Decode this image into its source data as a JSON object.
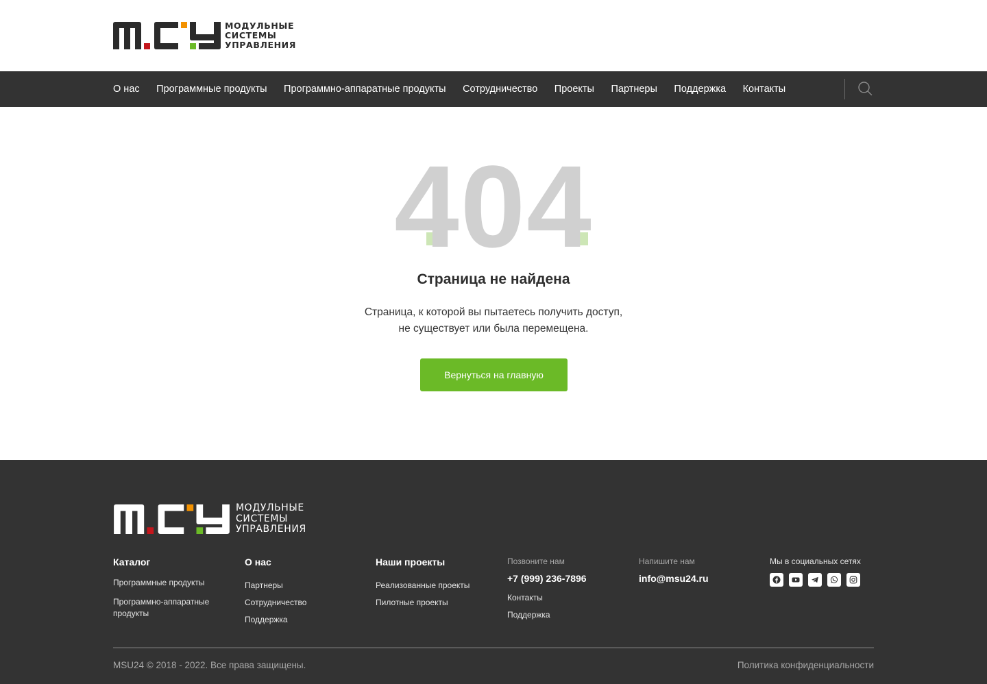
{
  "brand": {
    "text_lines": [
      "МОДУЛЬНЫЕ",
      "СИСТЕМЫ",
      "УПРАВЛЕНИЯ"
    ],
    "colors": {
      "red": "#c4161c",
      "orange": "#f39200",
      "green": "#6bba27",
      "dark": "#2b2b2b"
    }
  },
  "nav": {
    "items": [
      "О нас",
      "Программные продукты",
      "Программно-аппаратные продукты",
      "Сотрудничество",
      "Проекты",
      "Партнеры",
      "Поддержка",
      "Контакты"
    ],
    "search_icon": "search-icon"
  },
  "error": {
    "code": "404",
    "title": "Страница не найдена",
    "description_line1": "Страница, к которой вы пытаетесь получить доступ,",
    "description_line2": "не существует или была перемещена.",
    "button": "Вернуться на главную",
    "digit_color": "#d0d0d0",
    "accent_color": "#cde6b6"
  },
  "footer": {
    "catalog": {
      "title": "Каталог",
      "links": [
        "Программные продукты",
        "Программно-аппаратные продукты"
      ]
    },
    "about": {
      "title": "О нас",
      "links": [
        "Партнеры",
        "Сотрудничество",
        "Поддержка"
      ]
    },
    "projects": {
      "title": "Наши проекты",
      "links": [
        "Реализованные проекты",
        "Пилотные проекты"
      ]
    },
    "call": {
      "label": "Позвоните нам",
      "phone": "+7 (999) 236-7896",
      "links": [
        "Контакты",
        "Поддержка"
      ]
    },
    "write": {
      "label": "Напишите нам",
      "email": "info@msu24.ru"
    },
    "social": {
      "label": "Мы в социальных сетях",
      "icons": [
        "facebook-icon",
        "youtube-icon",
        "telegram-icon",
        "whatsapp-icon",
        "instagram-icon"
      ]
    },
    "copyright": "MSU24 © 2018 - 2022. Все права защищены.",
    "privacy": "Политика конфиденциальности"
  }
}
